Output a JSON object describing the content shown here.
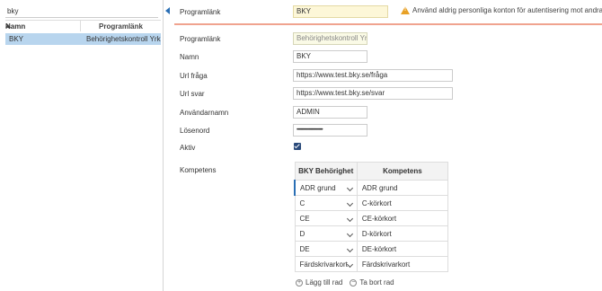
{
  "search": {
    "value": "bky"
  },
  "grid": {
    "headers": [
      "Namn",
      "Programlänk"
    ],
    "rows": [
      {
        "namn": "BKY",
        "programlank": "Behörighetskontroll Yrk..."
      }
    ]
  },
  "header": {
    "label": "Programlänk",
    "value": "BKY",
    "warning": "Använd aldrig personliga konton för autentisering mot andra system"
  },
  "form": {
    "programlank_label": "Programlänk",
    "programlank_value": "Behörighetskontroll Yrk...",
    "namn_label": "Namn",
    "namn_value": "BKY",
    "url_fraga_label": "Url fråga",
    "url_fraga_value": "https://www.test.bky.se/fråga",
    "url_svar_label": "Url svar",
    "url_svar_value": "https://www.test.bky.se/svar",
    "anvandarnamn_label": "Användarnamn",
    "anvandarnamn_value": "ADMIN",
    "losenord_label": "Lösenord",
    "losenord_value": "••••••••••••••••••••••••••",
    "aktiv_label": "Aktiv",
    "aktiv_checked": true,
    "kompetens_label": "Kompetens"
  },
  "kompetens": {
    "headers": [
      "BKY Behörighet",
      "Kompetens"
    ],
    "rows": [
      {
        "behorighet": "ADR grund",
        "kompetens": "ADR grund"
      },
      {
        "behorighet": "C",
        "kompetens": "C-körkort"
      },
      {
        "behorighet": "CE",
        "kompetens": "CE-körkort"
      },
      {
        "behorighet": "D",
        "kompetens": "D-körkort"
      },
      {
        "behorighet": "DE",
        "kompetens": "DE-körkort"
      },
      {
        "behorighet": "Färdskrivarkort",
        "kompetens": "Färdskrivarkort"
      }
    ]
  },
  "actions": {
    "add": "Lägg till rad",
    "remove": "Ta bort rad"
  },
  "icons": {
    "warning": "warning-triangle-icon",
    "collapse": "collapse-left-icon",
    "sort": "sort-asc-icon"
  },
  "colors": {
    "selection": "#b8d5ee",
    "accent": "#2a6fb5",
    "warning": "#e8a126",
    "divider": "#f0a38f"
  }
}
